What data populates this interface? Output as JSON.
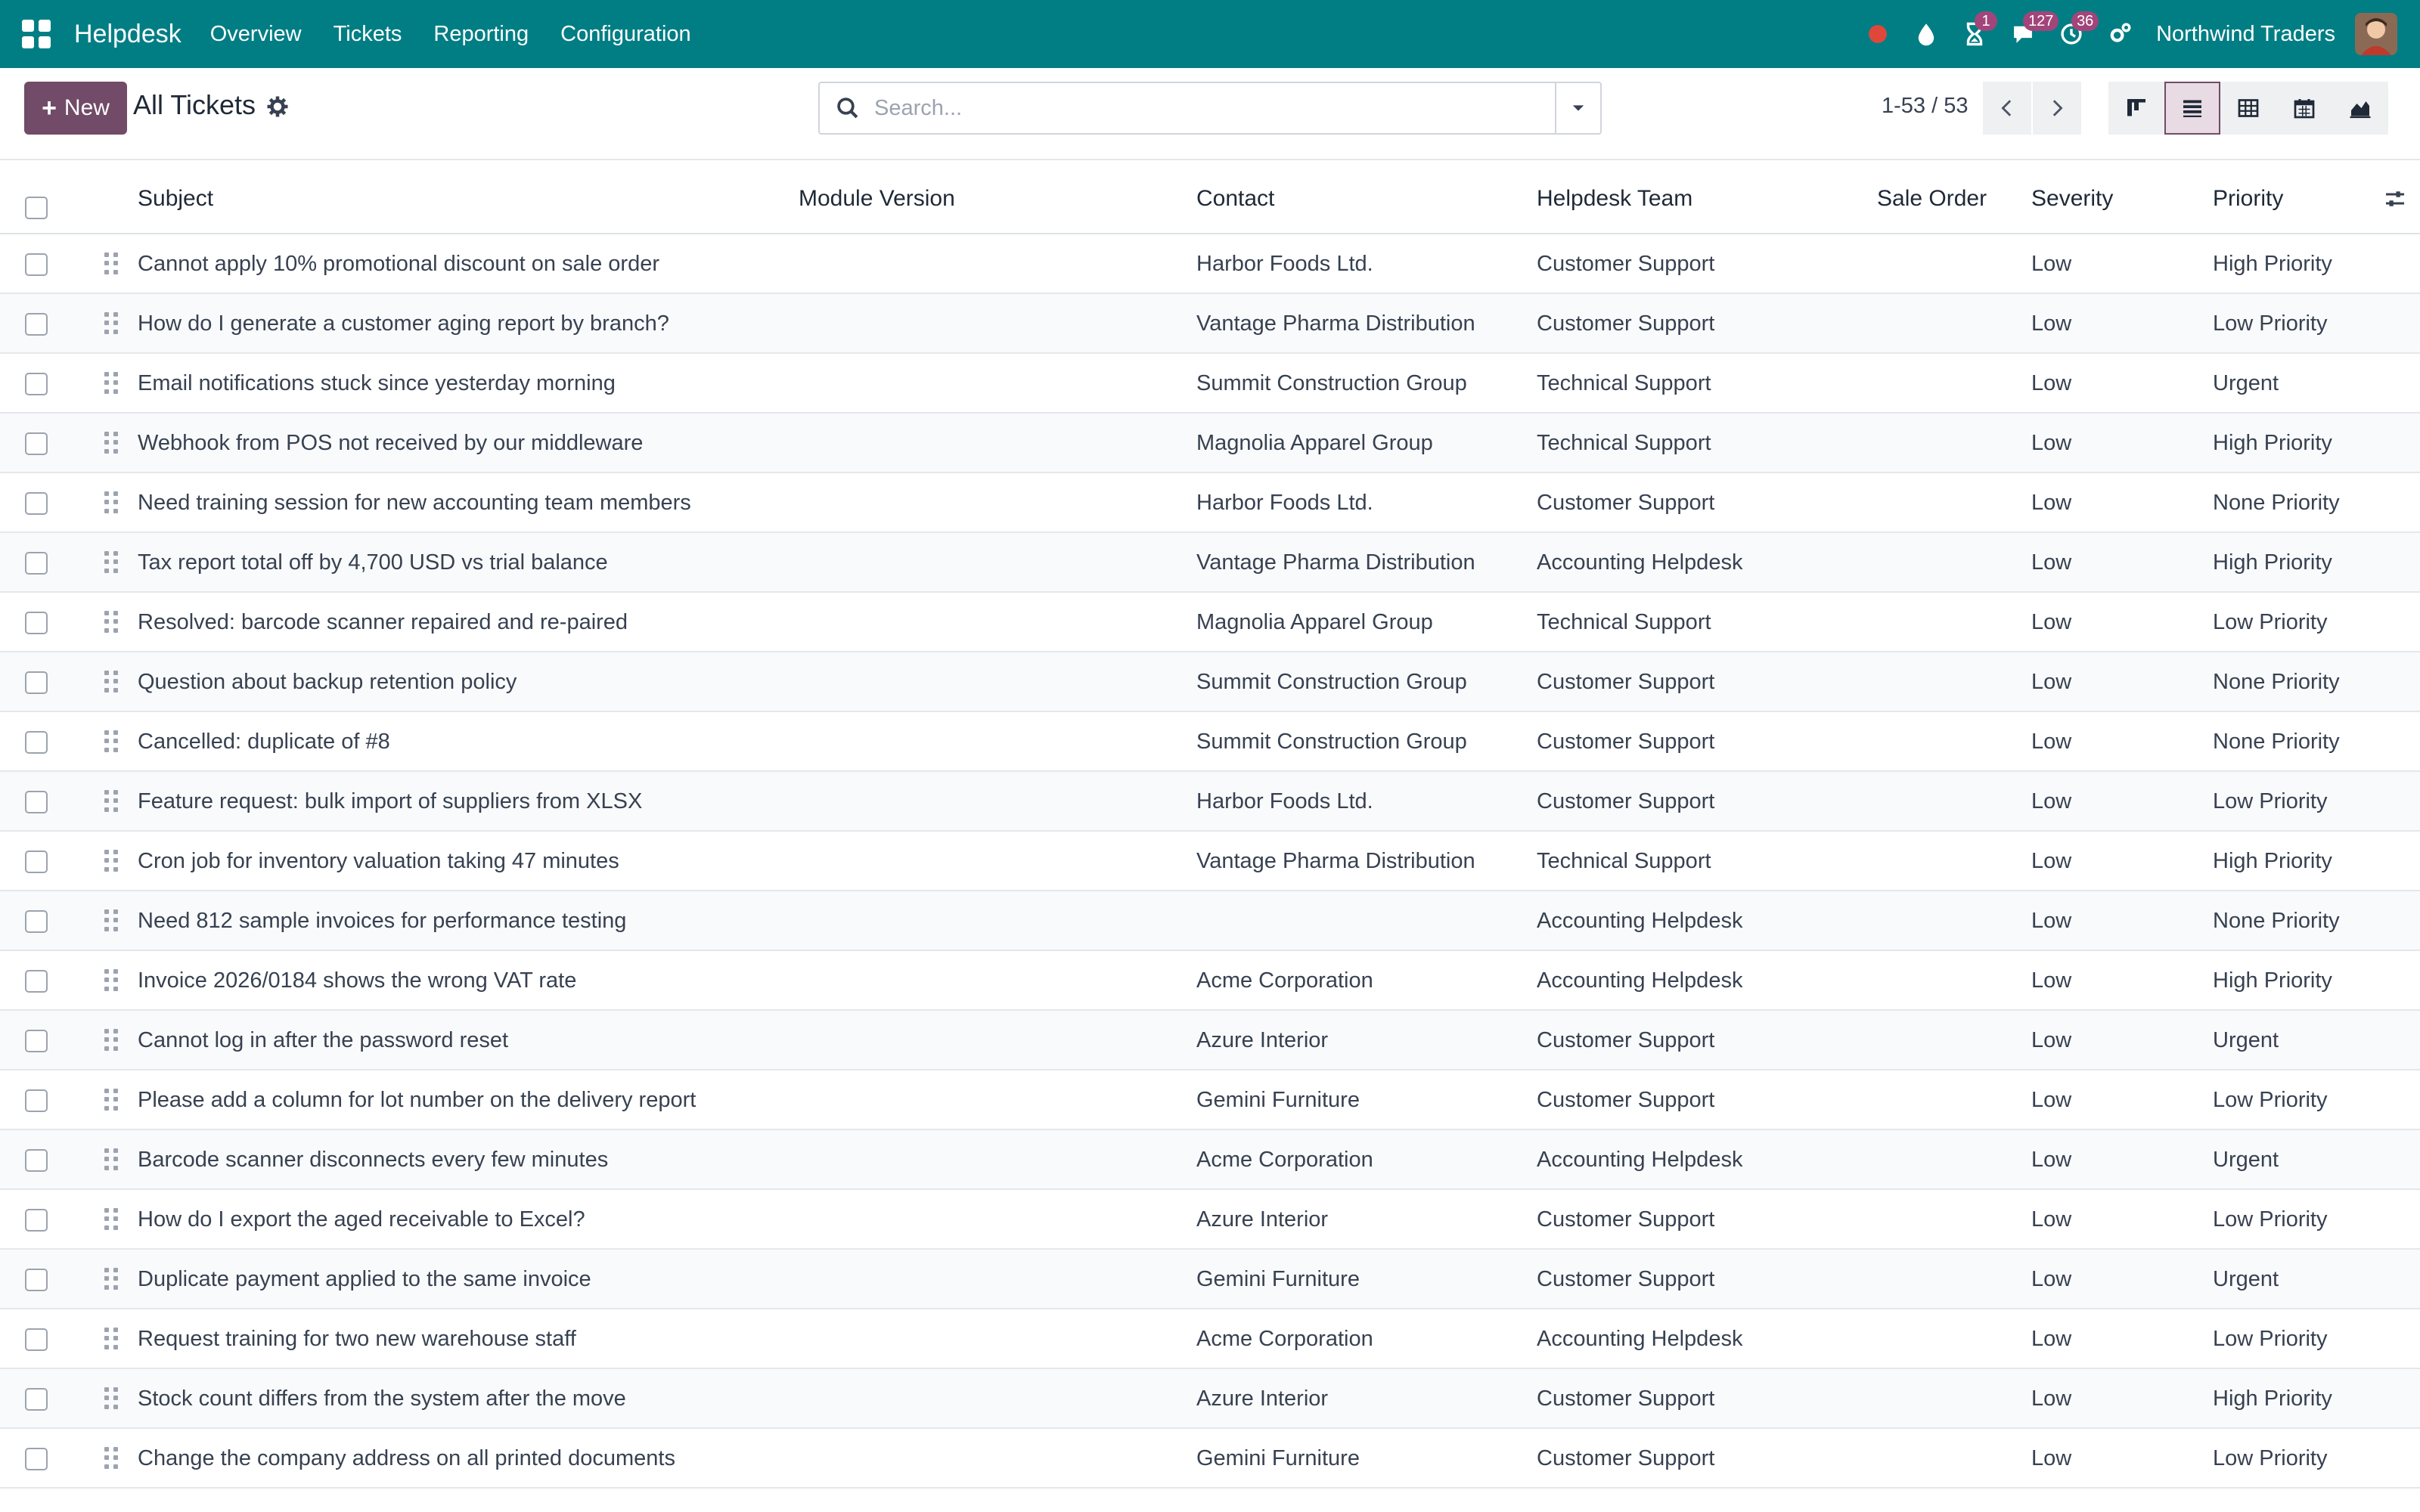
{
  "navbar": {
    "brand": "Helpdesk",
    "menu": [
      "Overview",
      "Tickets",
      "Reporting",
      "Configuration"
    ],
    "badges": {
      "activities": "1",
      "messages": "127",
      "timer": "36"
    },
    "company": "Northwind Traders",
    "icons": [
      "apps-grid-icon",
      "record-icon",
      "droplet-icon",
      "hourglass-icon",
      "chat-icon",
      "clock-icon",
      "settings-icon"
    ]
  },
  "control_panel": {
    "new_label": "New",
    "title": "All Tickets",
    "search_placeholder": "Search...",
    "pager": "1-53 / 53"
  },
  "list": {
    "columns": [
      "Subject",
      "Module Version",
      "Contact",
      "Helpdesk Team",
      "Sale Order",
      "Severity",
      "Priority"
    ],
    "rows": [
      {
        "subject": "Cannot apply 10% promotional discount on sale order",
        "module_version": "",
        "contact": "Harbor Foods Ltd.",
        "team": "Customer Support",
        "sale_order": "",
        "severity": "Low",
        "priority": "High Priority"
      },
      {
        "subject": "How do I generate a customer aging report by branch?",
        "module_version": "",
        "contact": "Vantage Pharma Distribution",
        "team": "Customer Support",
        "sale_order": "",
        "severity": "Low",
        "priority": "Low Priority"
      },
      {
        "subject": "Email notifications stuck since yesterday morning",
        "module_version": "",
        "contact": "Summit Construction Group",
        "team": "Technical Support",
        "sale_order": "",
        "severity": "Low",
        "priority": "Urgent"
      },
      {
        "subject": "Webhook from POS not received by our middleware",
        "module_version": "",
        "contact": "Magnolia Apparel Group",
        "team": "Technical Support",
        "sale_order": "",
        "severity": "Low",
        "priority": "High Priority"
      },
      {
        "subject": "Need training session for new accounting team members",
        "module_version": "",
        "contact": "Harbor Foods Ltd.",
        "team": "Customer Support",
        "sale_order": "",
        "severity": "Low",
        "priority": "None Priority"
      },
      {
        "subject": "Tax report total off by 4,700 USD vs trial balance",
        "module_version": "",
        "contact": "Vantage Pharma Distribution",
        "team": "Accounting Helpdesk",
        "sale_order": "",
        "severity": "Low",
        "priority": "High Priority"
      },
      {
        "subject": "Resolved: barcode scanner repaired and re-paired",
        "module_version": "",
        "contact": "Magnolia Apparel Group",
        "team": "Technical Support",
        "sale_order": "",
        "severity": "Low",
        "priority": "Low Priority"
      },
      {
        "subject": "Question about backup retention policy",
        "module_version": "",
        "contact": "Summit Construction Group",
        "team": "Customer Support",
        "sale_order": "",
        "severity": "Low",
        "priority": "None Priority"
      },
      {
        "subject": "Cancelled: duplicate of #8",
        "module_version": "",
        "contact": "Summit Construction Group",
        "team": "Customer Support",
        "sale_order": "",
        "severity": "Low",
        "priority": "None Priority"
      },
      {
        "subject": "Feature request: bulk import of suppliers from XLSX",
        "module_version": "",
        "contact": "Harbor Foods Ltd.",
        "team": "Customer Support",
        "sale_order": "",
        "severity": "Low",
        "priority": "Low Priority"
      },
      {
        "subject": "Cron job for inventory valuation taking 47 minutes",
        "module_version": "",
        "contact": "Vantage Pharma Distribution",
        "team": "Technical Support",
        "sale_order": "",
        "severity": "Low",
        "priority": "High Priority"
      },
      {
        "subject": "Need 812 sample invoices for performance testing",
        "module_version": "",
        "contact": "",
        "team": "Accounting Helpdesk",
        "sale_order": "",
        "severity": "Low",
        "priority": "None Priority"
      },
      {
        "subject": "Invoice 2026/0184 shows the wrong VAT rate",
        "module_version": "",
        "contact": "Acme Corporation",
        "team": "Accounting Helpdesk",
        "sale_order": "",
        "severity": "Low",
        "priority": "High Priority"
      },
      {
        "subject": "Cannot log in after the password reset",
        "module_version": "",
        "contact": "Azure Interior",
        "team": "Customer Support",
        "sale_order": "",
        "severity": "Low",
        "priority": "Urgent"
      },
      {
        "subject": "Please add a column for lot number on the delivery report",
        "module_version": "",
        "contact": "Gemini Furniture",
        "team": "Customer Support",
        "sale_order": "",
        "severity": "Low",
        "priority": "Low Priority"
      },
      {
        "subject": "Barcode scanner disconnects every few minutes",
        "module_version": "",
        "contact": "Acme Corporation",
        "team": "Accounting Helpdesk",
        "sale_order": "",
        "severity": "Low",
        "priority": "Urgent"
      },
      {
        "subject": "How do I export the aged receivable to Excel?",
        "module_version": "",
        "contact": "Azure Interior",
        "team": "Customer Support",
        "sale_order": "",
        "severity": "Low",
        "priority": "Low Priority"
      },
      {
        "subject": "Duplicate payment applied to the same invoice",
        "module_version": "",
        "contact": "Gemini Furniture",
        "team": "Customer Support",
        "sale_order": "",
        "severity": "Low",
        "priority": "Urgent"
      },
      {
        "subject": "Request training for two new warehouse staff",
        "module_version": "",
        "contact": "Acme Corporation",
        "team": "Accounting Helpdesk",
        "sale_order": "",
        "severity": "Low",
        "priority": "Low Priority"
      },
      {
        "subject": "Stock count differs from the system after the move",
        "module_version": "",
        "contact": "Azure Interior",
        "team": "Customer Support",
        "sale_order": "",
        "severity": "Low",
        "priority": "High Priority"
      },
      {
        "subject": "Change the company address on all printed documents",
        "module_version": "",
        "contact": "Gemini Furniture",
        "team": "Customer Support",
        "sale_order": "",
        "severity": "Low",
        "priority": "Low Priority"
      }
    ]
  },
  "colors": {
    "navbar": "#017e84",
    "primary": "#714b67",
    "badge": "#a2457a",
    "record": "#e0473b"
  }
}
